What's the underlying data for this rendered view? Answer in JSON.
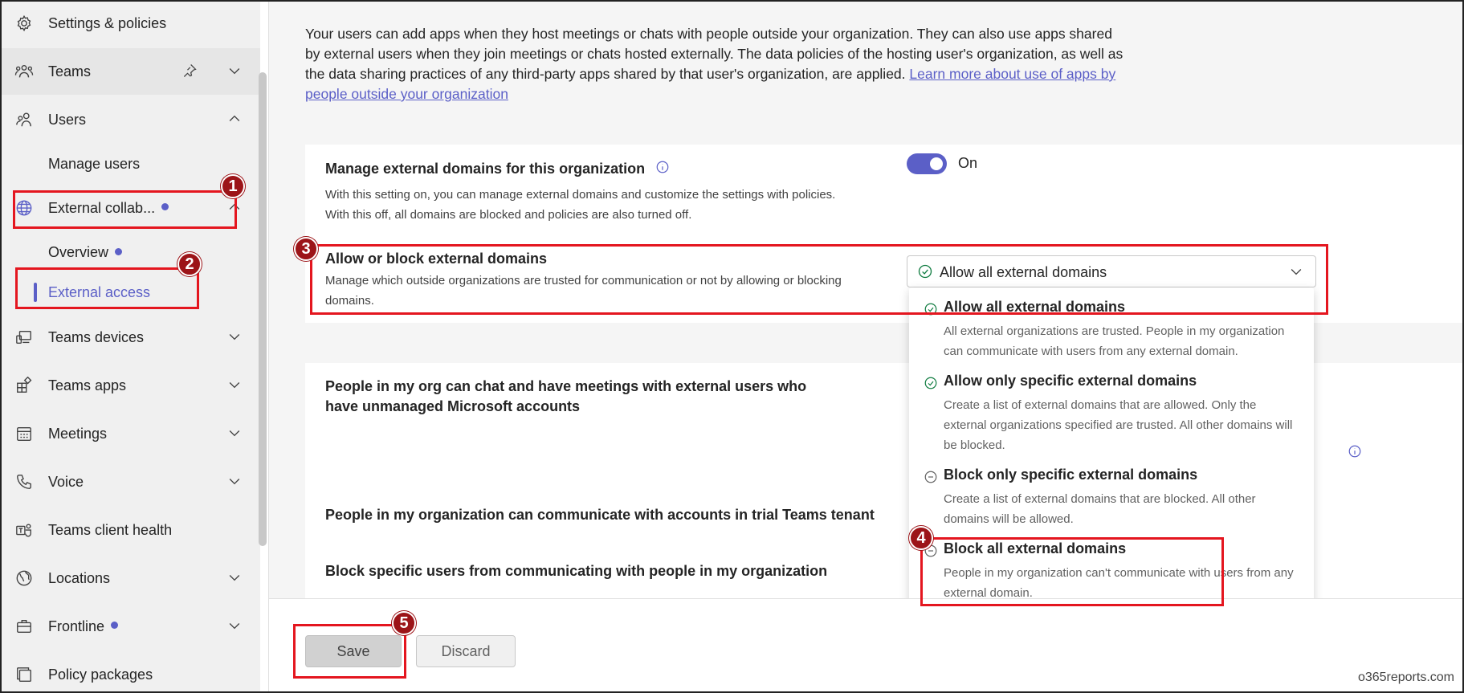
{
  "sidebar": {
    "items": [
      {
        "label": "Settings & policies"
      },
      {
        "label": "Teams"
      },
      {
        "label": "Users"
      },
      {
        "label": "Teams devices"
      },
      {
        "label": "Teams apps"
      },
      {
        "label": "Meetings"
      },
      {
        "label": "Voice"
      },
      {
        "label": "Teams client health"
      },
      {
        "label": "Locations"
      },
      {
        "label": "Frontline"
      },
      {
        "label": "Policy packages"
      }
    ],
    "users_sub": {
      "manage_users": "Manage users",
      "external_collab": "External collab..."
    },
    "external_sub": {
      "overview": "Overview",
      "external_access": "External access"
    }
  },
  "main": {
    "intro_text": "Your users can add apps when they host meetings or chats with people outside your organization. They can also use apps shared by external users when they join meetings or chats hosted externally. The data policies of the hosting user's organization, as well as the data sharing practices of any third-party apps shared by that user's organization, are applied. ",
    "intro_link": "Learn more about use of apps by people outside your organization",
    "manage_domains": {
      "title": "Manage external domains for this organization",
      "desc1": "With this setting on, you can manage external domains and customize the settings with policies.",
      "desc2": "With this off, all domains are blocked and policies are also turned off.",
      "toggle_label": "On"
    },
    "allow_block": {
      "title": "Allow or block external domains",
      "desc": "Manage which outside organizations are trusted for communication or not by allowing or blocking domains.",
      "selected": "Allow all external domains"
    },
    "dropdown_options": [
      {
        "title": "Allow all external domains",
        "desc": "All external organizations are trusted. People in my organization can communicate with users from any external domain.",
        "icon": "check-circle-icon"
      },
      {
        "title": "Allow only specific external domains",
        "desc": "Create a list of external domains that are allowed. Only the external organizations specified are trusted. All other domains will be blocked.",
        "icon": "check-circle-icon"
      },
      {
        "title": "Block only specific external domains",
        "desc": "Create a list of external domains that are blocked. All other domains will be allowed.",
        "icon": "minus-circle-icon"
      },
      {
        "title": "Block all external domains",
        "desc": "People in my organization can't communicate with users from any external domain.",
        "icon": "minus-circle-icon"
      }
    ],
    "unmanaged": {
      "title": "People in my org can chat and have meetings with external users who have unmanaged Microsoft accounts"
    },
    "trial": {
      "title": "People in my organization can communicate with accounts in trial Teams tenant"
    },
    "block_users": {
      "title": "Block specific users from communicating with people in my organization"
    }
  },
  "footer": {
    "save": "Save",
    "discard": "Discard",
    "watermark": "o365reports.com"
  },
  "annotations": [
    "1",
    "2",
    "3",
    "4",
    "5"
  ],
  "colors": {
    "accent": "#5b5fc7",
    "annotation_red": "#e4161f",
    "badge": "#9c1418"
  }
}
